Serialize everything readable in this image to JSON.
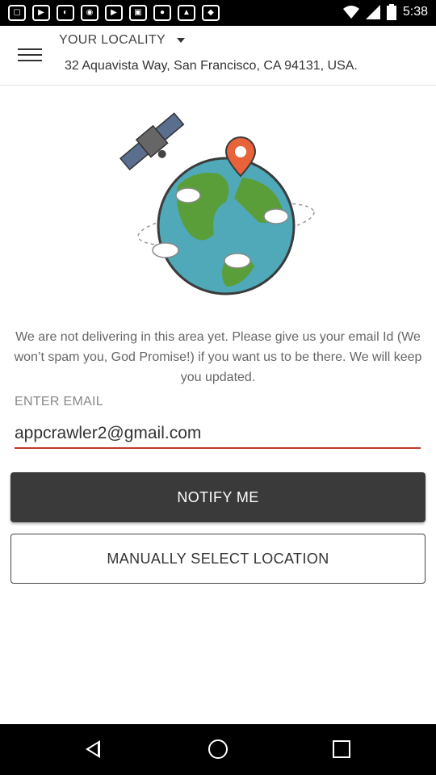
{
  "status_bar": {
    "time": "5:38",
    "left_icons": [
      "notification-icon",
      "notification-icon",
      "notification-icon",
      "notification-icon",
      "notification-icon",
      "notification-icon",
      "notification-icon",
      "notification-icon",
      "notification-icon"
    ],
    "right_icons": [
      "wifi-icon",
      "signal-icon",
      "battery-icon"
    ]
  },
  "header": {
    "locality_label": "YOUR LOCALITY",
    "address": "32 Aquavista Way, San Francisco, CA 94131, USA."
  },
  "colors": {
    "globe_ocean": "#4fa9b8",
    "globe_land": "#5a9e3a",
    "pin": "#e8633a",
    "button_dark": "#3a3a3a",
    "underline": "#c0392b"
  },
  "main": {
    "message": "We are not delivering in this area yet. Please give us your email Id (We won’t spam you, God Promise!) if you want us to be there. We will keep you updated.",
    "email_label": "ENTER EMAIL",
    "email_value": "appcrawler2@gmail.com",
    "notify_label": "NOTIFY ME",
    "manual_label": "MANUALLY SELECT LOCATION"
  }
}
